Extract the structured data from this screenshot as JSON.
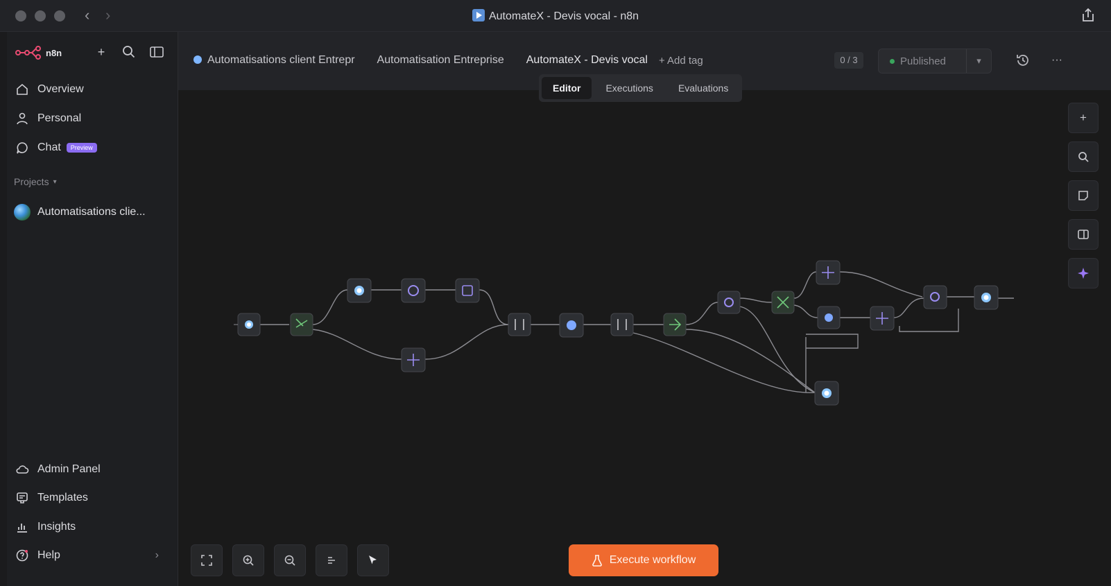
{
  "window": {
    "title": "AutomateX - Devis vocal - n8n"
  },
  "sidebar": {
    "brand": "n8n",
    "nav": [
      {
        "label": "Overview",
        "icon": "home-icon"
      },
      {
        "label": "Personal",
        "icon": "user-icon"
      },
      {
        "label": "Chat",
        "icon": "chat-icon",
        "badge": "Preview"
      }
    ],
    "projects_label": "Projects",
    "project": "Automatisations clie...",
    "bottom_nav": [
      {
        "label": "Admin Panel",
        "icon": "cloud-icon"
      },
      {
        "label": "Templates",
        "icon": "templates-icon"
      },
      {
        "label": "Insights",
        "icon": "insights-icon"
      },
      {
        "label": "Help",
        "icon": "help-icon"
      }
    ]
  },
  "header": {
    "breadcrumbs": [
      "Automatisations client Entrepr",
      "Automatisation Entreprise",
      "AutomateX - Devis vocal"
    ],
    "add_tag": "+ Add tag",
    "counter": "0 / 3",
    "publish_label": "Published",
    "tabs": [
      {
        "label": "Editor",
        "active": true
      },
      {
        "label": "Executions",
        "active": false
      },
      {
        "label": "Evaluations",
        "active": false
      }
    ]
  },
  "canvas": {
    "execute_label": "Execute workflow",
    "colors": {
      "accent": "#ef6a2f",
      "node_bg": "#2d2f33",
      "edge": "#8c8c92"
    }
  }
}
